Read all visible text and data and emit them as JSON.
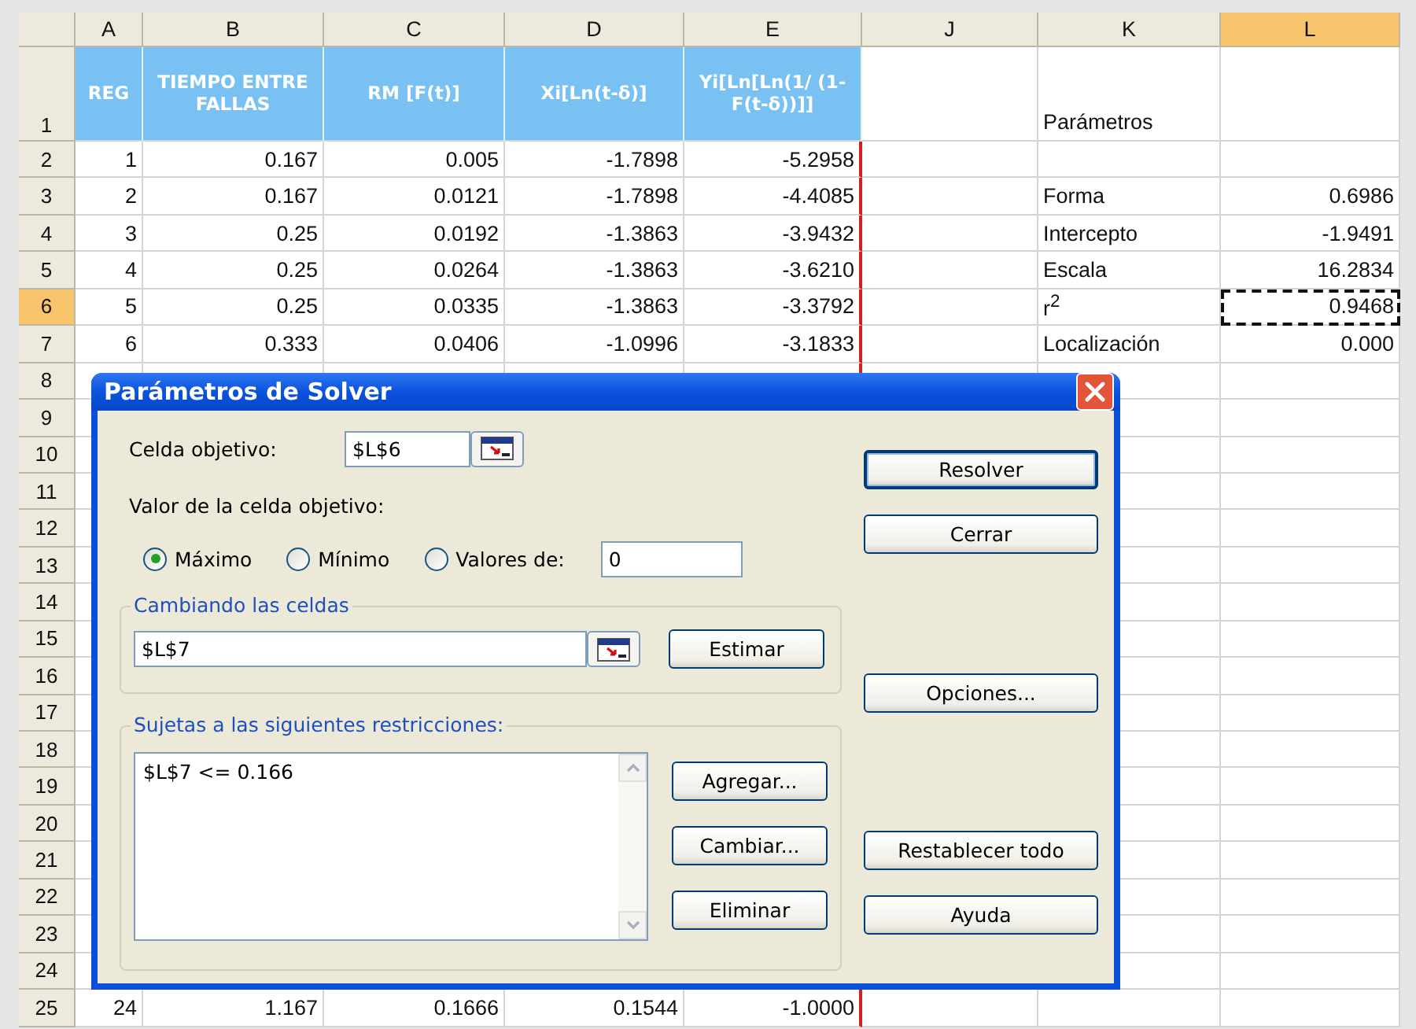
{
  "columns": [
    {
      "label": "A",
      "selected": false
    },
    {
      "label": "B",
      "selected": false
    },
    {
      "label": "C",
      "selected": false
    },
    {
      "label": "D",
      "selected": false
    },
    {
      "label": "E",
      "selected": false
    },
    {
      "label": "J",
      "selected": false
    },
    {
      "label": "K",
      "selected": false
    },
    {
      "label": "L",
      "selected": true
    }
  ],
  "header_row": {
    "number": "1",
    "selected": false,
    "titles": [
      "REG",
      "TIEMPO ENTRE FALLAS",
      "RM [F(t)]",
      "Xi[Ln(t-δ)]",
      "Yi[Ln[Ln(1/ (1-F(t-δ))]]"
    ],
    "parameter_heading": "Parámetros"
  },
  "rows": [
    {
      "number": "2",
      "selected": false,
      "values": [
        "1",
        "0.167",
        "0.005",
        "-1.7898",
        "-5.2958"
      ]
    },
    {
      "number": "3",
      "selected": false,
      "values": [
        "2",
        "0.167",
        "0.0121",
        "-1.7898",
        "-4.4085"
      ],
      "parameter": {
        "label": "Forma",
        "value": "0.6986",
        "marquee": false
      }
    },
    {
      "number": "4",
      "selected": false,
      "values": [
        "3",
        "0.25",
        "0.0192",
        "-1.3863",
        "-3.9432"
      ],
      "parameter": {
        "label": "Intercepto",
        "value": "-1.9491",
        "marquee": false
      }
    },
    {
      "number": "5",
      "selected": false,
      "values": [
        "4",
        "0.25",
        "0.0264",
        "-1.3863",
        "-3.6210"
      ],
      "parameter": {
        "label": "Escala",
        "value": "16.2834",
        "marquee": false
      }
    },
    {
      "number": "6",
      "selected": true,
      "values": [
        "5",
        "0.25",
        "0.0335",
        "-1.3863",
        "-3.3792"
      ],
      "parameter": {
        "label": "r$^{2}$",
        "value": "0.9468",
        "marquee": true
      }
    },
    {
      "number": "7",
      "selected": false,
      "values": [
        "6",
        "0.333",
        "0.0406",
        "-1.0996",
        "-3.1833"
      ],
      "parameter": {
        "label": "Localización",
        "value": "0.000",
        "marquee": false
      }
    },
    {
      "number": "8",
      "selected": false
    },
    {
      "number": "9",
      "selected": false
    },
    {
      "number": "10",
      "selected": false
    },
    {
      "number": "11",
      "selected": false
    },
    {
      "number": "12",
      "selected": false
    },
    {
      "number": "13",
      "selected": false
    },
    {
      "number": "14",
      "selected": false
    },
    {
      "number": "15",
      "selected": false
    },
    {
      "number": "16",
      "selected": false
    },
    {
      "number": "17",
      "selected": false
    },
    {
      "number": "18",
      "selected": false
    },
    {
      "number": "19",
      "selected": false
    },
    {
      "number": "20",
      "selected": false
    },
    {
      "number": "21",
      "selected": false
    },
    {
      "number": "22",
      "selected": false
    },
    {
      "number": "23",
      "selected": false
    },
    {
      "number": "24",
      "selected": false
    },
    {
      "number": "25",
      "selected": false,
      "values": [
        "24",
        "1.167",
        "0.1666",
        "0.1544",
        "-1.0000"
      ]
    }
  ],
  "dialog": {
    "title": "Parámetros de Solver",
    "target": {
      "label": "Celda objetivo:",
      "value": "$L$6"
    },
    "value_label": "Valor de la celda objetivo:",
    "options": [
      {
        "label": "Máximo",
        "selected": true
      },
      {
        "label": "Mínimo",
        "selected": false
      },
      {
        "label": "Valores de:",
        "selected": false
      }
    ],
    "value_of": "0",
    "changing": {
      "legend": "Cambiando las celdas",
      "value": "$L$7",
      "button": {
        "label": "Estimar"
      }
    },
    "constraints": {
      "legend": "Sujetas a las siguientes restricciones:",
      "items": [
        "$L$7 <= 0.166"
      ],
      "buttons": [
        {
          "label": "Agregar..."
        },
        {
          "label": "Cambiar..."
        },
        {
          "label": "Eliminar"
        }
      ]
    },
    "side_buttons": [
      {
        "label": "Resolver",
        "default": true
      },
      {
        "label": "Cerrar",
        "default": false
      },
      {
        "label": "Opciones...",
        "default": false
      },
      {
        "label": "Restablecer todo",
        "default": false
      },
      {
        "label": "Ayuda",
        "default": false
      }
    ]
  }
}
